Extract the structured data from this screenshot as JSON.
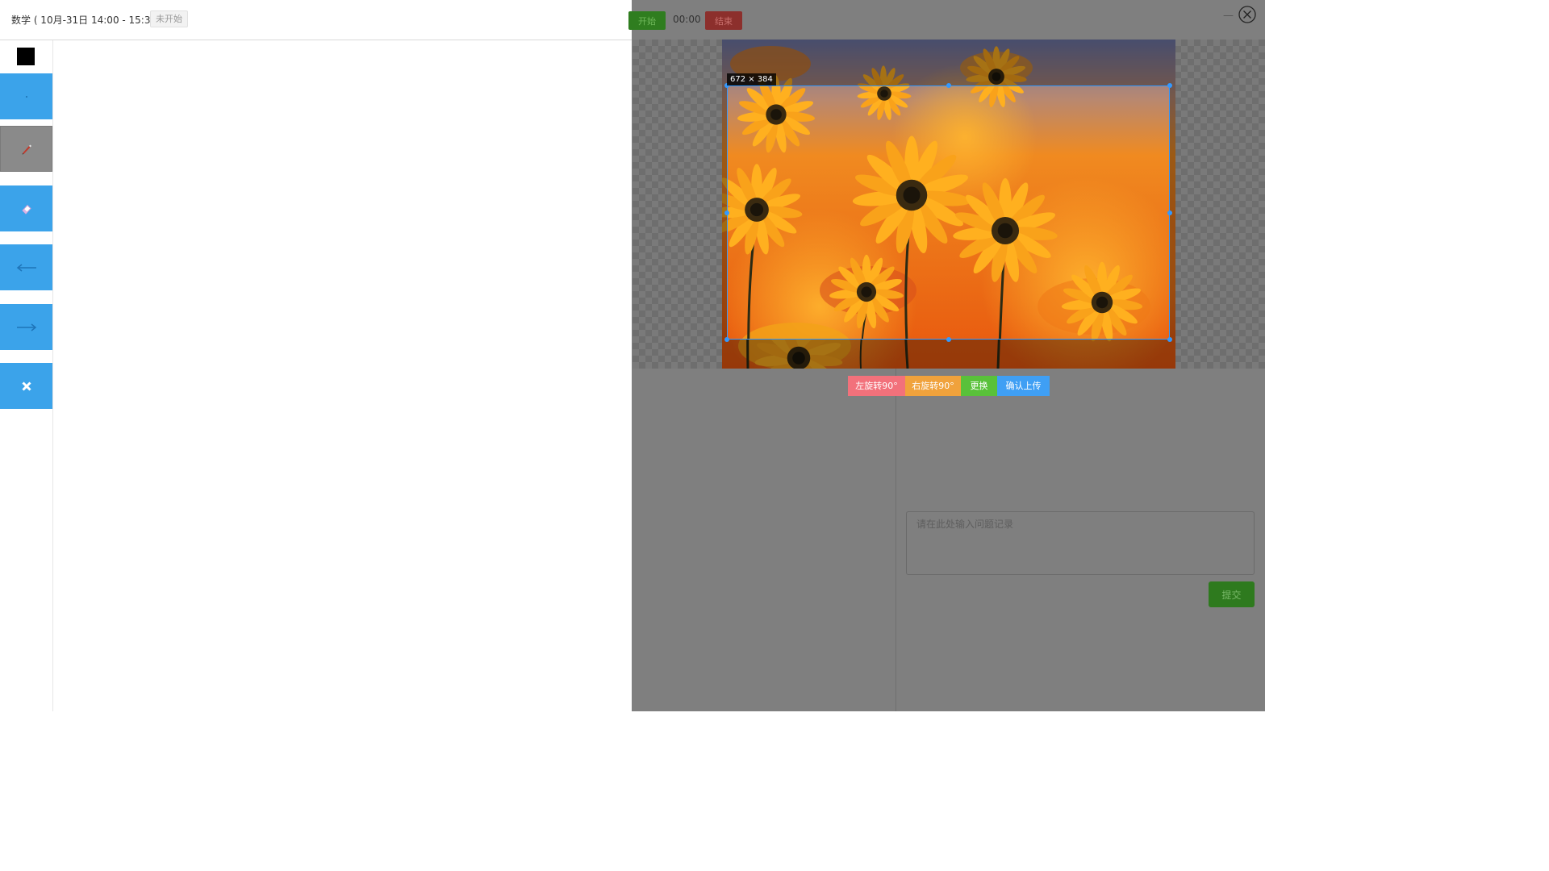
{
  "header": {
    "course_title": "数学 ( 10月-31日 14:00 - 15:30 )",
    "status": "未开始"
  },
  "toolbar": {
    "current_color": "#000000",
    "tools": [
      {
        "name": "dot-tool",
        "icon": "dot-icon"
      },
      {
        "name": "pen-tool",
        "icon": "pen-icon",
        "active": true
      },
      {
        "name": "eraser-tool",
        "icon": "eraser-icon"
      },
      {
        "name": "undo-tool",
        "icon": "arrow-left-icon"
      },
      {
        "name": "redo-tool",
        "icon": "arrow-right-icon"
      },
      {
        "name": "clear-tool",
        "icon": "close-icon"
      }
    ]
  },
  "controls": {
    "start_label": "开始",
    "timer": "00:00",
    "end_label": "结束",
    "minimize": "—"
  },
  "cropper": {
    "size_label": "672 × 384",
    "rotate_left_label": "左旋转90°",
    "rotate_right_label": "右旋转90°",
    "replace_label": "更换",
    "confirm_label": "确认上传"
  },
  "note": {
    "placeholder": "请在此处输入问题记录",
    "submit_label": "提交"
  },
  "colors": {
    "tool_blue": "#3ba3ea",
    "overlay_gray": "#7f7f7f",
    "crop_border": "#3399ff"
  }
}
